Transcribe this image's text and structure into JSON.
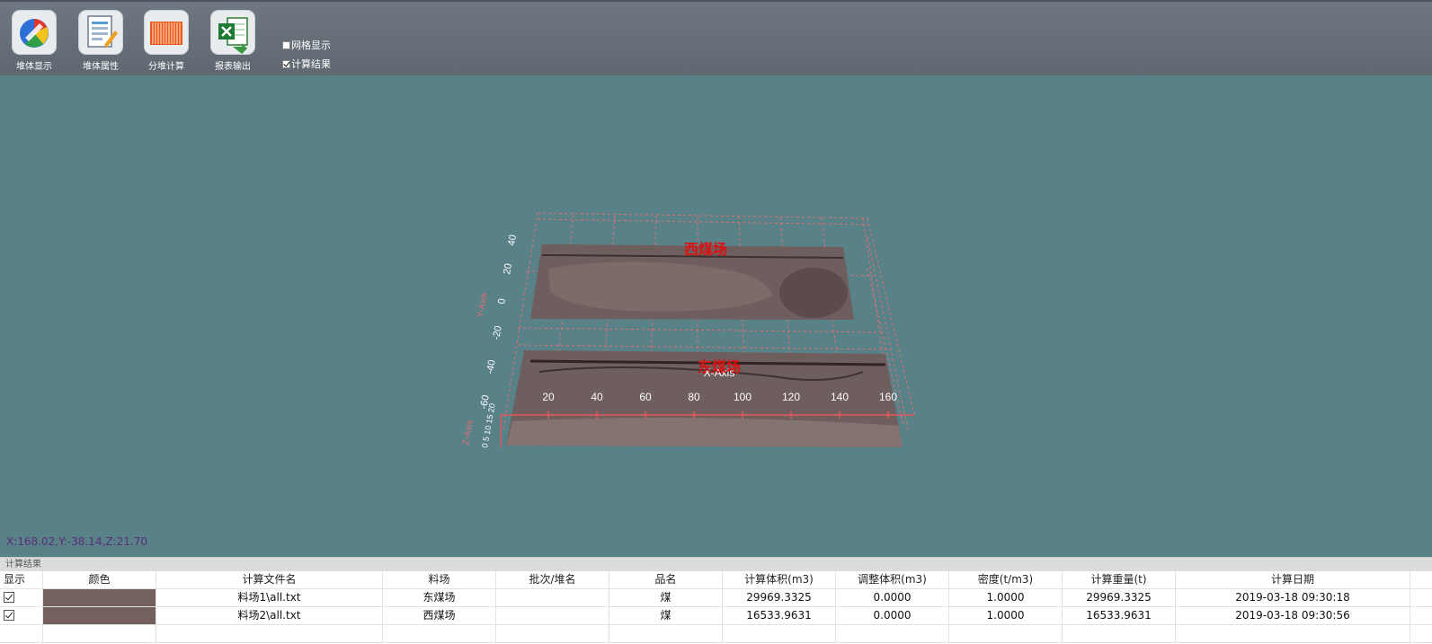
{
  "toolbar": {
    "buttons": [
      {
        "label": "堆体显示",
        "icon": "pie-chart-icon"
      },
      {
        "label": "堆体属性",
        "icon": "properties-document-icon"
      },
      {
        "label": "分堆计算",
        "icon": "pile-bars-icon"
      },
      {
        "label": "报表输出",
        "icon": "excel-export-icon"
      }
    ],
    "checkboxes": [
      {
        "label": "网格显示",
        "checked": false
      },
      {
        "label": "计算结果",
        "checked": true
      }
    ]
  },
  "scene": {
    "pile_labels": [
      "西煤场",
      "东煤场"
    ],
    "axis_titles": {
      "x": "X-Axis",
      "y": "Y-Axis",
      "z": "Z-Axis"
    },
    "x_ticks": [
      "20",
      "40",
      "60",
      "80",
      "100",
      "120",
      "140",
      "160"
    ],
    "y_ticks": [
      "40",
      "20",
      "0",
      "-20",
      "-40",
      "-60"
    ],
    "z_ticks": "0 5 10 15 20",
    "coords": "X:168.02,Y:-38.14,Z:21.70",
    "colors": {
      "background": "#588188",
      "pile": "#6e5e5e",
      "grid": "#e07070",
      "label": "#dd1111"
    }
  },
  "results": {
    "title": "计算结果",
    "columns": [
      "显示",
      "颜色",
      "计算文件名",
      "料场",
      "批次/堆名",
      "品名",
      "计算体积(m3)",
      "调整体积(m3)",
      "密度(t/m3)",
      "计算重量(t)",
      "计算日期"
    ],
    "rows": [
      {
        "show": true,
        "color": "#74605f",
        "file": "料场1\\all.txt",
        "yard": "东煤场",
        "batch": "",
        "product": "煤",
        "volume": "29969.3325",
        "adjusted": "0.0000",
        "density": "1.0000",
        "weight": "29969.3325",
        "date": "2019-03-18 09:30:18"
      },
      {
        "show": true,
        "color": "#74605f",
        "file": "料场2\\all.txt",
        "yard": "西煤场",
        "batch": "",
        "product": "煤",
        "volume": "16533.9631",
        "adjusted": "0.0000",
        "density": "1.0000",
        "weight": "16533.9631",
        "date": "2019-03-18 09:30:56"
      }
    ]
  }
}
